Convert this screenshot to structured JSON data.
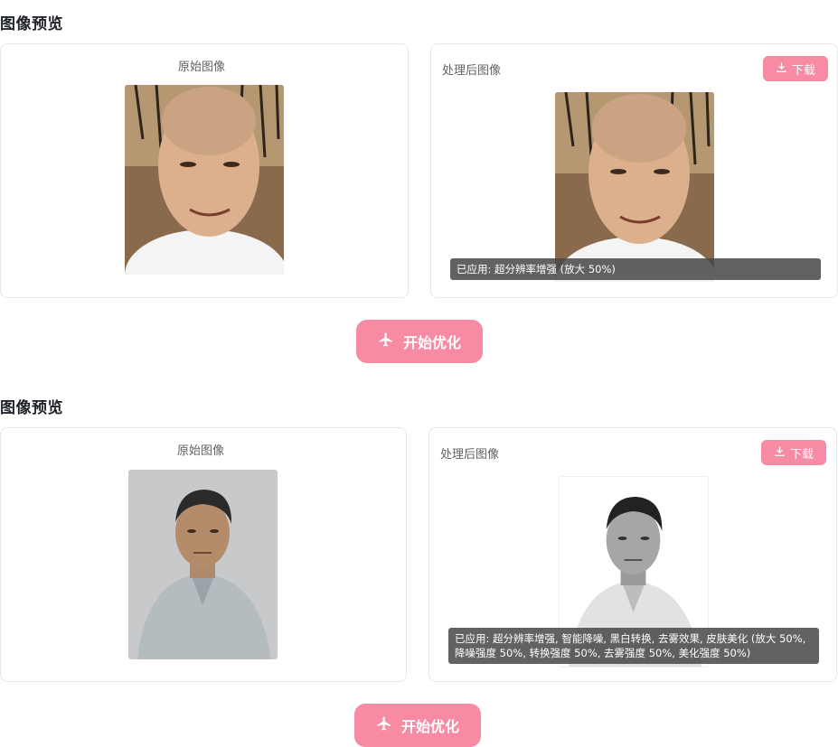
{
  "sections": [
    {
      "title": "图像预览",
      "original_label": "原始图像",
      "processed_label": "处理后图像",
      "download_label": "下载",
      "applied_text": "已应用: 超分辨率增强 (放大 50%)",
      "start_label": "开始优化"
    },
    {
      "title": "图像预览",
      "original_label": "原始图像",
      "processed_label": "处理后图像",
      "download_label": "下载",
      "applied_text": "已应用: 超分辨率增强, 智能降噪, 黑白转换, 去雾效果, 皮肤美化 (放大 50%, 降噪强度 50%, 转换强度 50%, 去雾强度 50%, 美化强度 50%)",
      "start_label": "开始优化"
    }
  ],
  "colors": {
    "accent": "#f78ba3",
    "border": "#e6e8eb",
    "overlay": "#464646"
  },
  "icons": [
    "download-icon",
    "airplane-icon"
  ]
}
